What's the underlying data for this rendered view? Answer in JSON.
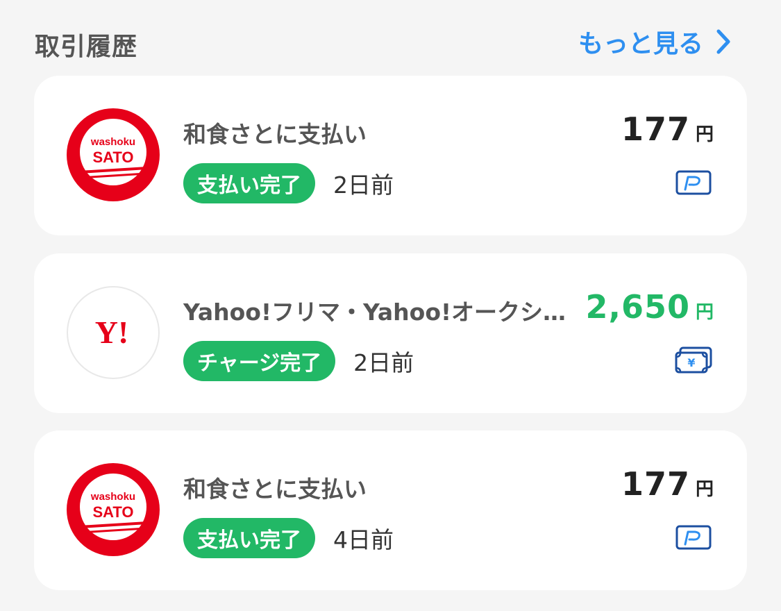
{
  "header": {
    "title": "取引履歴",
    "more_label": "もっと見る",
    "more_icon": "chevron-right-icon"
  },
  "colors": {
    "accent_blue": "#2e8ff0",
    "charge_green": "#22b866",
    "brand_red": "#e60019",
    "paypay_blue": "#1c4fa0"
  },
  "transactions": [
    {
      "logo": {
        "name": "washoku-sato-logo",
        "top_text": "washoku",
        "main_text": "SATO"
      },
      "merchant": "和食さとに支払い",
      "status": "支払い完了",
      "when": "2日前",
      "amount": "177",
      "currency": "円",
      "kind": "payment",
      "method_icon": "paypay-money-icon"
    },
    {
      "logo": {
        "name": "yahoo-logo",
        "main_text": "Y!"
      },
      "merchant": "Yahoo!フリマ・Yahoo!オークシ…",
      "status": "チャージ完了",
      "when": "2日前",
      "amount": "2,650",
      "currency": "円",
      "kind": "charge",
      "method_icon": "yen-bill-icon"
    },
    {
      "logo": {
        "name": "washoku-sato-logo",
        "top_text": "washoku",
        "main_text": "SATO"
      },
      "merchant": "和食さとに支払い",
      "status": "支払い完了",
      "when": "4日前",
      "amount": "177",
      "currency": "円",
      "kind": "payment",
      "method_icon": "paypay-money-icon"
    }
  ]
}
